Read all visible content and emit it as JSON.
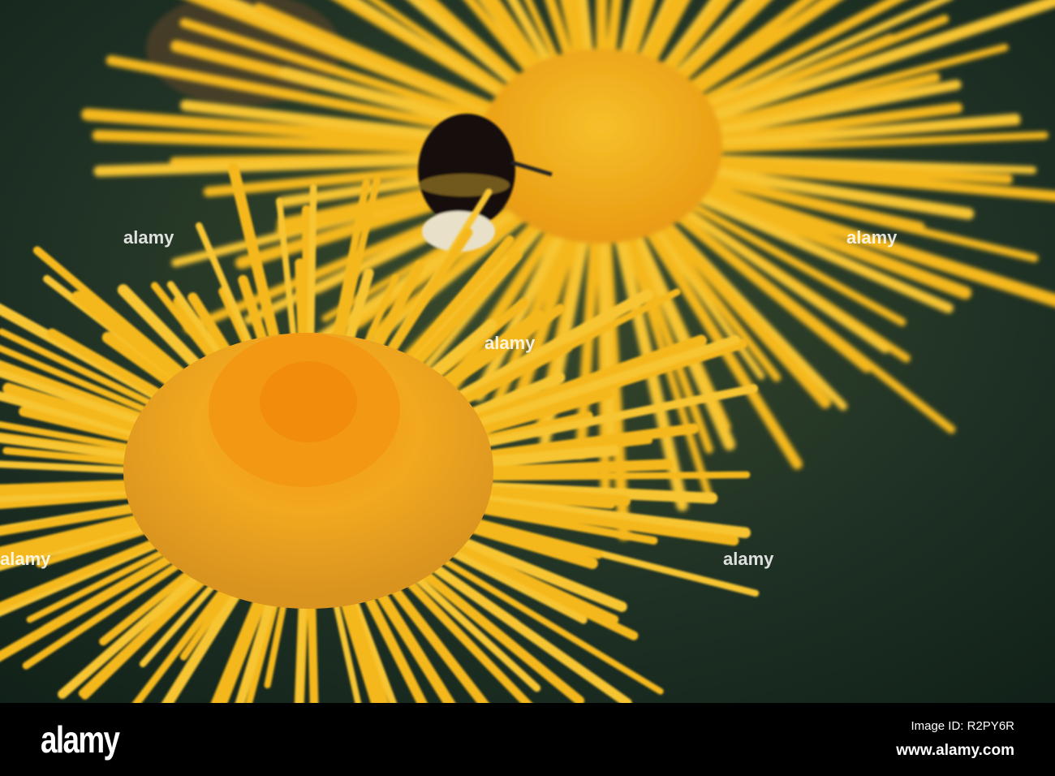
{
  "photo": {
    "subject": "yellow flowers with bumblebee",
    "colors": {
      "background": "#1f3326",
      "petal": "#f5b81a",
      "disc": "#f0a51e",
      "disc_center": "#f59a10",
      "bee": "#111111"
    }
  },
  "watermark": "alamy",
  "footer": {
    "logo": "alamy",
    "image_id": "Image ID: R2PY6R",
    "site": "www.alamy.com"
  }
}
